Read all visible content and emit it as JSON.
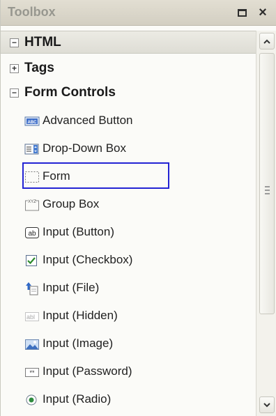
{
  "toolbox": {
    "title": "Toolbox",
    "restore_label": "",
    "close_label": "×"
  },
  "categories": [
    {
      "label": "HTML",
      "expander": "−",
      "state": "expanded"
    },
    {
      "label": "Tags",
      "expander": "+",
      "state": "collapsed"
    },
    {
      "label": "Form Controls",
      "expander": "−",
      "state": "expanded"
    }
  ],
  "items": [
    {
      "label": "Advanced Button",
      "icon": "advanced-button-icon"
    },
    {
      "label": "Drop-Down Box",
      "icon": "dropdown-box-icon"
    },
    {
      "label": "Form",
      "icon": "form-icon",
      "selected": true
    },
    {
      "label": "Group Box",
      "icon": "group-box-icon"
    },
    {
      "label": "Input (Button)",
      "icon": "input-button-icon"
    },
    {
      "label": "Input (Checkbox)",
      "icon": "input-checkbox-icon"
    },
    {
      "label": "Input (File)",
      "icon": "input-file-icon"
    },
    {
      "label": "Input (Hidden)",
      "icon": "input-hidden-icon"
    },
    {
      "label": "Input (Image)",
      "icon": "input-image-icon"
    },
    {
      "label": "Input (Password)",
      "icon": "input-password-icon"
    },
    {
      "label": "Input (Radio)",
      "icon": "input-radio-icon"
    }
  ],
  "colors": {
    "selection_border": "#2323d4",
    "title_text": "#97978f"
  }
}
